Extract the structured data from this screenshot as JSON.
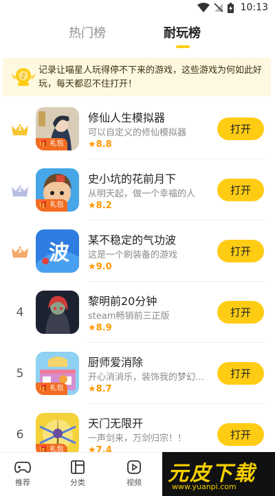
{
  "status_bar": {
    "time": "10:13"
  },
  "tabs": [
    {
      "label": "热门榜",
      "active": false
    },
    {
      "label": "耐玩榜",
      "active": true
    }
  ],
  "colors": {
    "accent": "#ffcc14",
    "gold": "#ff9800",
    "gift": "#f36c21",
    "banner_bg": "#fff8e1"
  },
  "banner": {
    "text": "记录让喵星人玩得停不下来的游戏，这些游戏为何如此好玩，每天都忍不住打开！"
  },
  "games": [
    {
      "rank": "1",
      "rank_style": "gold-crown",
      "title": "修仙人生模拟器",
      "desc": "可以自定义的修仙模拟器",
      "score": "8.8",
      "gift": "礼包",
      "button": "打开"
    },
    {
      "rank": "2",
      "rank_style": "silver-crown",
      "title": "史小坑的花前月下",
      "desc": "从明天起，做一个幸福的人",
      "score": "8.2",
      "gift": "礼包",
      "button": "打开"
    },
    {
      "rank": "3",
      "rank_style": "bronze-crown",
      "title": "某不稳定的气功波",
      "desc": "这是一个刷装备的游戏",
      "score": "9.0",
      "gift": "",
      "button": "打开"
    },
    {
      "rank": "4",
      "rank_style": "number",
      "title": "黎明前20分钟",
      "desc": "steam畅销前三正版",
      "score": "8.9",
      "gift": "",
      "button": "打开"
    },
    {
      "rank": "5",
      "rank_style": "number",
      "title": "厨师爱消除",
      "desc": "开心消消乐，装饰我的梦幻…",
      "score": "8.7",
      "gift": "礼包",
      "button": "打开"
    },
    {
      "rank": "6",
      "rank_style": "number",
      "title": "天门无限开",
      "desc": "一声剑来，万剑归宗！！",
      "score": "7.4",
      "gift": "礼包",
      "button": "打开"
    }
  ],
  "bottom_nav": [
    {
      "label": "推荐",
      "icon": "gamepad-icon"
    },
    {
      "label": "分类",
      "icon": "category-icon"
    },
    {
      "label": "视频",
      "icon": "play-icon"
    }
  ],
  "watermark": {
    "big": "元皮下载",
    "small": "www.yuanpi.com"
  }
}
